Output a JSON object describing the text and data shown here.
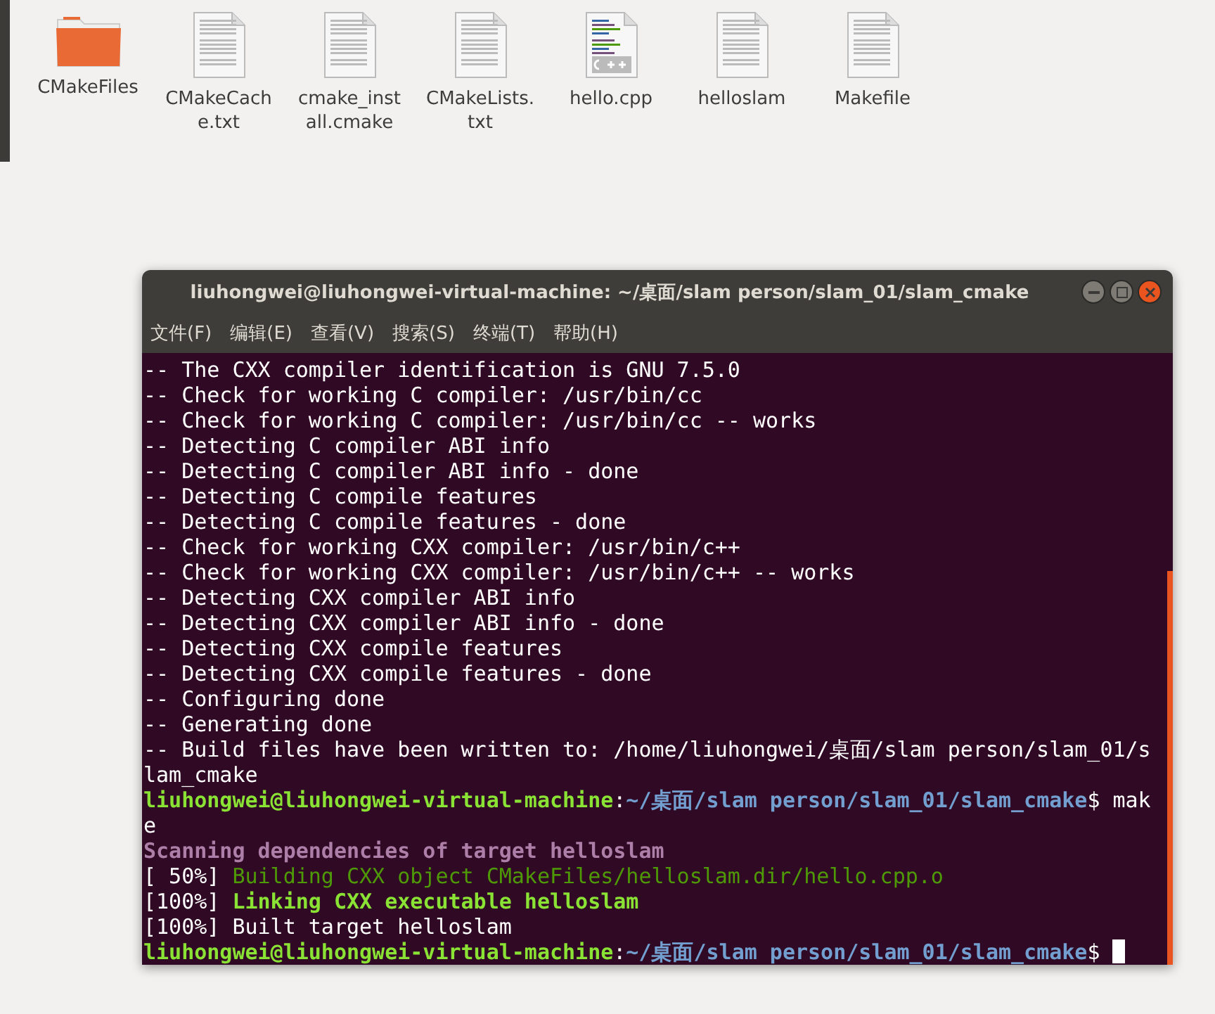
{
  "files": [
    {
      "name": "CMakeFiles",
      "kind": "folder"
    },
    {
      "name": "CMakeCache.txt",
      "kind": "text"
    },
    {
      "name": "cmake_install.cmake",
      "kind": "text"
    },
    {
      "name": "CMakeLists.txt",
      "kind": "text"
    },
    {
      "name": "hello.cpp",
      "kind": "cpp"
    },
    {
      "name": "helloslam",
      "kind": "text"
    },
    {
      "name": "Makefile",
      "kind": "text"
    }
  ],
  "terminal": {
    "title": "liuhongwei@liuhongwei-virtual-machine: ~/桌面/slam person/slam_01/slam_cmake",
    "menu": [
      "文件(F)",
      "编辑(E)",
      "查看(V)",
      "搜索(S)",
      "终端(T)",
      "帮助(H)"
    ],
    "lines": [
      [
        {
          "text": "-- The CXX compiler identification is GNU 7.5.0",
          "kind": "plain"
        }
      ],
      [
        {
          "text": "-- Check for working C compiler: /usr/bin/cc",
          "kind": "plain"
        }
      ],
      [
        {
          "text": "-- Check for working C compiler: /usr/bin/cc -- works",
          "kind": "plain"
        }
      ],
      [
        {
          "text": "-- Detecting C compiler ABI info",
          "kind": "plain"
        }
      ],
      [
        {
          "text": "-- Detecting C compiler ABI info - done",
          "kind": "plain"
        }
      ],
      [
        {
          "text": "-- Detecting C compile features",
          "kind": "plain"
        }
      ],
      [
        {
          "text": "-- Detecting C compile features - done",
          "kind": "plain"
        }
      ],
      [
        {
          "text": "-- Check for working CXX compiler: /usr/bin/c++",
          "kind": "plain"
        }
      ],
      [
        {
          "text": "-- Check for working CXX compiler: /usr/bin/c++ -- works",
          "kind": "plain"
        }
      ],
      [
        {
          "text": "-- Detecting CXX compiler ABI info",
          "kind": "plain"
        }
      ],
      [
        {
          "text": "-- Detecting CXX compiler ABI info - done",
          "kind": "plain"
        }
      ],
      [
        {
          "text": "-- Detecting CXX compile features",
          "kind": "plain"
        }
      ],
      [
        {
          "text": "-- Detecting CXX compile features - done",
          "kind": "plain"
        }
      ],
      [
        {
          "text": "-- Configuring done",
          "kind": "plain"
        }
      ],
      [
        {
          "text": "-- Generating done",
          "kind": "plain"
        }
      ],
      [
        {
          "text": "-- Build files have been written to: /home/liuhongwei/桌面/slam person/slam_01/slam_cmake",
          "kind": "plain"
        }
      ],
      [
        {
          "text": "liuhongwei@liuhongwei-virtual-machine",
          "kind": "user"
        },
        {
          "text": ":",
          "kind": "plain"
        },
        {
          "text": "~/桌面/slam person/slam_01/slam_cmake",
          "kind": "path"
        },
        {
          "text": "$ make",
          "kind": "plain"
        }
      ],
      [
        {
          "text": "Scanning dependencies of target helloslam",
          "kind": "scan"
        }
      ],
      [
        {
          "text": "[ 50%] ",
          "kind": "plain"
        },
        {
          "text": "Building CXX object CMakeFiles/helloslam.dir/hello.cpp.o",
          "kind": "build"
        }
      ],
      [
        {
          "text": "[100%] ",
          "kind": "plain"
        },
        {
          "text": "Linking CXX executable helloslam",
          "kind": "link"
        }
      ],
      [
        {
          "text": "[100%] Built target helloslam",
          "kind": "plain"
        }
      ],
      [
        {
          "text": "liuhongwei@liuhongwei-virtual-machine",
          "kind": "user"
        },
        {
          "text": ":",
          "kind": "plain"
        },
        {
          "text": "~/桌面/slam person/slam_01/slam_cmake",
          "kind": "path"
        },
        {
          "text": "$ ",
          "kind": "plain"
        }
      ]
    ]
  }
}
